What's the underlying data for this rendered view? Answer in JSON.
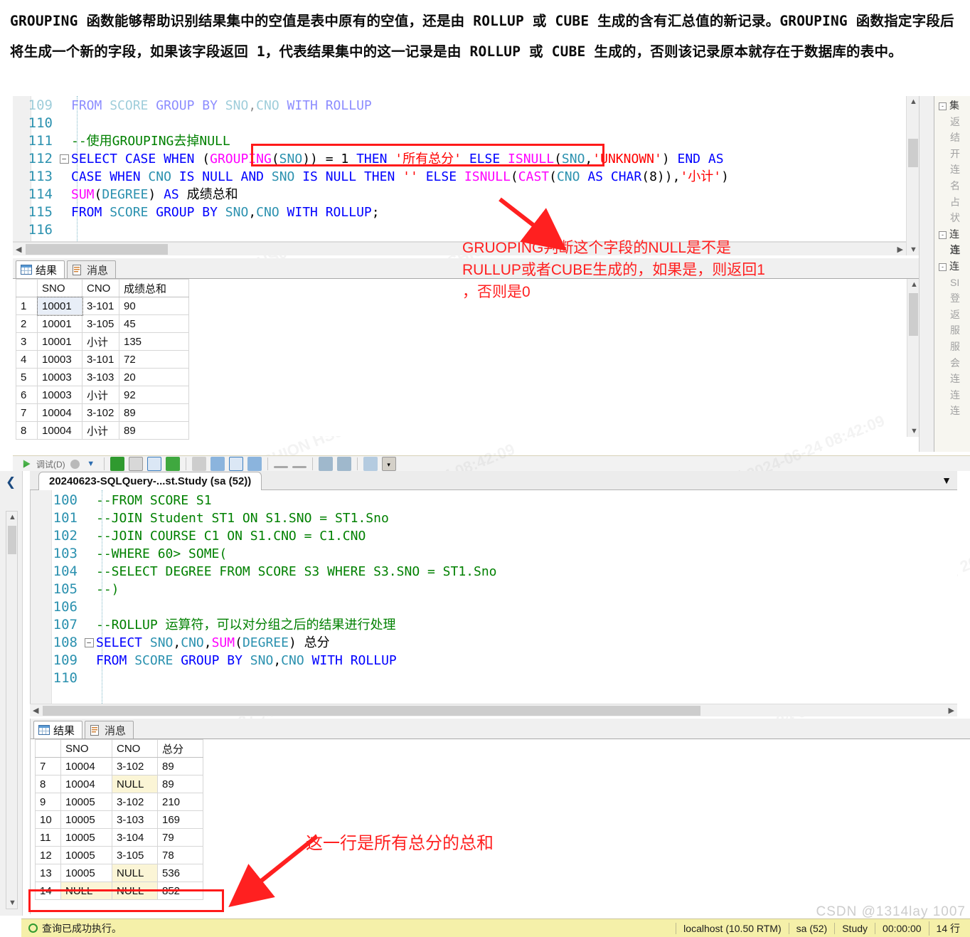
{
  "intro": {
    "paragraph": "GROUPING 函数能够帮助识别结果集中的空值是表中原有的空值，还是由 ROLLUP 或 CUBE 生成的含有汇总值的新记录。GROUPING 函数指定字段后将生成一个新的字段，如果该字段返回 1，代表结果集中的这一记录是由 ROLLUP 或 CUBE 生成的，否则该记录原本就存在于数据库的表中。"
  },
  "editor_top": {
    "lines": [
      {
        "num": "109",
        "text": "FROM SCORE GROUP BY SNO,CNO WITH ROLLUP",
        "clipped": true
      },
      {
        "num": "110",
        "text": ""
      },
      {
        "num": "111",
        "text": "--使用GROUPING去掉NULL"
      },
      {
        "num": "112",
        "text": "SELECT CASE WHEN (GROUPING(SNO)) = 1 THEN '所有总分' ELSE ISNULL(SNO,'UNKNOWN') END AS"
      },
      {
        "num": "113",
        "text": "CASE WHEN CNO IS NULL AND SNO IS NULL THEN '' ELSE ISNULL(CAST(CNO AS CHAR(8)),'小计')"
      },
      {
        "num": "114",
        "text": "SUM(DEGREE) AS 成绩总和"
      },
      {
        "num": "115",
        "text": "FROM SCORE GROUP BY SNO,CNO WITH ROLLUP;"
      },
      {
        "num": "116",
        "text": ""
      }
    ]
  },
  "annotation_top": {
    "text": "GRUOPING判断这个字段的NULL是不是\nRULLUP或者CUBE生成的，如果是，则返回1\n，否则是0",
    "color": "#ff2020"
  },
  "results_top": {
    "tabs": [
      {
        "label": "结果",
        "icon": "grid-icon",
        "active": true
      },
      {
        "label": "消息",
        "icon": "message-icon",
        "active": false
      }
    ],
    "columns": [
      "",
      "SNO",
      "CNO",
      "成绩总和"
    ],
    "rows": [
      {
        "n": "1",
        "sno": "10001",
        "cno": "3-101",
        "sum": "90",
        "selected": true
      },
      {
        "n": "2",
        "sno": "10001",
        "cno": "3-105",
        "sum": "45"
      },
      {
        "n": "3",
        "sno": "10001",
        "cno": "小计",
        "sum": "135"
      },
      {
        "n": "4",
        "sno": "10003",
        "cno": "3-101",
        "sum": "72"
      },
      {
        "n": "5",
        "sno": "10003",
        "cno": "3-103",
        "sum": "20"
      },
      {
        "n": "6",
        "sno": "10003",
        "cno": "小计",
        "sum": "92"
      },
      {
        "n": "7",
        "sno": "10004",
        "cno": "3-102",
        "sum": "89"
      },
      {
        "n": "8",
        "sno": "10004",
        "cno": "小计",
        "sum": "89"
      }
    ]
  },
  "editor_bottom": {
    "tab_title": "20240623-SQLQuery-...st.Study (sa (52))",
    "lines": [
      {
        "num": "100",
        "text": "--FROM SCORE S1"
      },
      {
        "num": "101",
        "text": "--JOIN Student ST1 ON S1.SNO = ST1.Sno"
      },
      {
        "num": "102",
        "text": "--JOIN COURSE C1 ON S1.CNO = C1.CNO"
      },
      {
        "num": "103",
        "text": "--WHERE 60> SOME("
      },
      {
        "num": "104",
        "text": "--SELECT DEGREE FROM SCORE S3 WHERE S3.SNO = ST1.Sno"
      },
      {
        "num": "105",
        "text": "--)"
      },
      {
        "num": "106",
        "text": ""
      },
      {
        "num": "107",
        "text": "--ROLLUP 运算符，可以对分组之后的结果进行处理"
      },
      {
        "num": "108",
        "text": "SELECT SNO,CNO,SUM(DEGREE) 总分"
      },
      {
        "num": "109",
        "text": "FROM SCORE GROUP BY SNO,CNO WITH ROLLUP"
      },
      {
        "num": "110",
        "text": ""
      }
    ]
  },
  "results_bottom": {
    "tabs": [
      {
        "label": "结果",
        "icon": "grid-icon",
        "active": true
      },
      {
        "label": "消息",
        "icon": "message-icon",
        "active": false
      }
    ],
    "columns": [
      "",
      "SNO",
      "CNO",
      "总分"
    ],
    "rows": [
      {
        "n": "7",
        "sno": "10004",
        "cno": "3-102",
        "sum": "89"
      },
      {
        "n": "8",
        "sno": "10004",
        "cno": "NULL",
        "sum": "89",
        "cno_null": true
      },
      {
        "n": "9",
        "sno": "10005",
        "cno": "3-102",
        "sum": "210"
      },
      {
        "n": "10",
        "sno": "10005",
        "cno": "3-103",
        "sum": "169"
      },
      {
        "n": "11",
        "sno": "10005",
        "cno": "3-104",
        "sum": "79"
      },
      {
        "n": "12",
        "sno": "10005",
        "cno": "3-105",
        "sum": "78"
      },
      {
        "n": "13",
        "sno": "10005",
        "cno": "NULL",
        "sum": "536",
        "cno_null": true
      },
      {
        "n": "14",
        "sno": "NULL",
        "cno": "NULL",
        "sum": "852",
        "sno_null": true,
        "cno_null": true,
        "highlighted": true
      }
    ]
  },
  "annotation_bottom": {
    "text": "这一行是所有总分的总和",
    "color": "#ff2020"
  },
  "statusbar": {
    "state": "查询已成功执行。",
    "server": "localhost (10.50 RTM)",
    "user": "sa (52)",
    "database": "Study",
    "elapsed": "00:00:00",
    "rows": "14 行"
  },
  "property_panel": {
    "rows": [
      {
        "text": "集",
        "kind": "hdr",
        "box": "-"
      },
      {
        "text": "返"
      },
      {
        "text": "结"
      },
      {
        "text": "开"
      },
      {
        "text": "连"
      },
      {
        "text": "名"
      },
      {
        "text": "占"
      },
      {
        "text": "状"
      },
      {
        "text": "连",
        "kind": "hdr",
        "box": "-"
      },
      {
        "text": "连",
        "kind": "bold"
      },
      {
        "text": "连",
        "kind": "hdr",
        "box": "-"
      },
      {
        "text": "SI"
      },
      {
        "text": "登"
      },
      {
        "text": "返"
      },
      {
        "text": "服"
      },
      {
        "text": "服"
      },
      {
        "text": "会"
      },
      {
        "text": "连"
      },
      {
        "text": "连"
      },
      {
        "text": "连"
      }
    ]
  },
  "watermark": {
    "text": "HOSHION HS003372 HS0627 刘共猪 2024-06-24 08:38:09",
    "text_alt": "HOSHION HS003372 HS0627 刘共猪 2024-06-24 08:42:09",
    "csdn": "CSDN @1314lay 1007"
  }
}
